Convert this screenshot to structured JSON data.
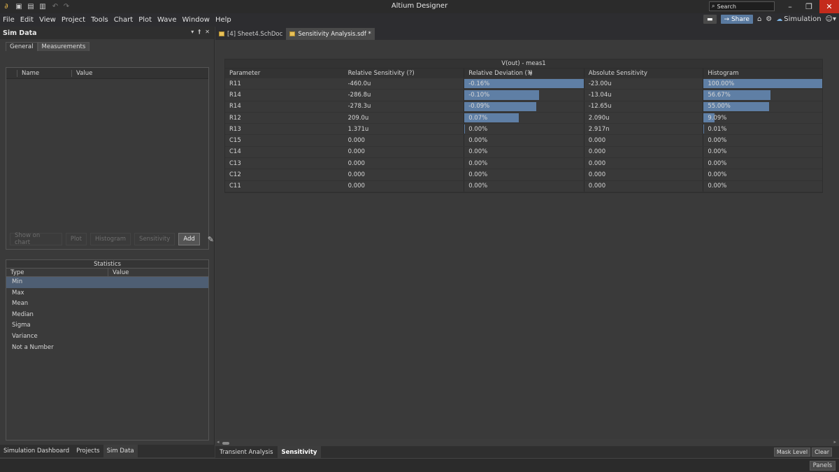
{
  "app": {
    "title": "Altium Designer",
    "search_placeholder": "Search"
  },
  "menu": [
    "File",
    "Edit",
    "View",
    "Project",
    "Tools",
    "Chart",
    "Plot",
    "Wave",
    "Window",
    "Help"
  ],
  "toolbar_right": {
    "share": "Share",
    "simulation": "Simulation"
  },
  "left_panel": {
    "title": "Sim Data",
    "tabs": [
      "General",
      "Measurements"
    ],
    "measure_columns": [
      "Name",
      "Value"
    ],
    "buttons": [
      "Show on chart",
      "Plot",
      "Histogram",
      "Sensitivity",
      "Add"
    ],
    "stats": {
      "title": "Statistics",
      "columns": [
        "Type",
        "Value"
      ],
      "rows": [
        "Min",
        "Max",
        "Mean",
        "Median",
        "Sigma",
        "Variance",
        "Not a Number"
      ]
    },
    "bottom_tabs": [
      "Simulation Dashboard",
      "Projects",
      "Sim Data"
    ]
  },
  "doc_tabs": [
    "[4] Sheet4.SchDoc",
    "Sensitivity Analysis.sdf *"
  ],
  "table": {
    "title": "V(out) - meas1",
    "columns": [
      "Parameter",
      "Relative Sensitivity (?)",
      "Relative Deviation (?)",
      "Absolute Sensitivity",
      "Histogram"
    ],
    "rows": [
      {
        "param": "R11",
        "rel_sens": "-460.0u",
        "rel_dev": "-0.16%",
        "rel_dev_frac": 1.0,
        "abs_sens": "-23.00u",
        "hist": "100.00%",
        "hist_frac": 1.0
      },
      {
        "param": "R14",
        "rel_sens": "-286.8u",
        "rel_dev": "-0.10%",
        "rel_dev_frac": 0.625,
        "abs_sens": "-13.04u",
        "hist": "56.67%",
        "hist_frac": 0.5667
      },
      {
        "param": "R14",
        "rel_sens": "-278.3u",
        "rel_dev": "-0.09%",
        "rel_dev_frac": 0.605,
        "abs_sens": "-12.65u",
        "hist": "55.00%",
        "hist_frac": 0.55
      },
      {
        "param": "R12",
        "rel_sens": "209.0u",
        "rel_dev": "0.07%",
        "rel_dev_frac": 0.454,
        "abs_sens": "2.090u",
        "hist": "9.09%",
        "hist_frac": 0.0909
      },
      {
        "param": "R13",
        "rel_sens": "1.371u",
        "rel_dev": "0.00%",
        "rel_dev_frac": 0.005,
        "abs_sens": "2.917n",
        "hist": "0.01%",
        "hist_frac": 0.005
      },
      {
        "param": "C15",
        "rel_sens": "0.000",
        "rel_dev": "0.00%",
        "rel_dev_frac": 0,
        "abs_sens": "0.000",
        "hist": "0.00%",
        "hist_frac": 0
      },
      {
        "param": "C14",
        "rel_sens": "0.000",
        "rel_dev": "0.00%",
        "rel_dev_frac": 0,
        "abs_sens": "0.000",
        "hist": "0.00%",
        "hist_frac": 0
      },
      {
        "param": "C13",
        "rel_sens": "0.000",
        "rel_dev": "0.00%",
        "rel_dev_frac": 0,
        "abs_sens": "0.000",
        "hist": "0.00%",
        "hist_frac": 0
      },
      {
        "param": "C12",
        "rel_sens": "0.000",
        "rel_dev": "0.00%",
        "rel_dev_frac": 0,
        "abs_sens": "0.000",
        "hist": "0.00%",
        "hist_frac": 0
      },
      {
        "param": "C11",
        "rel_sens": "0.000",
        "rel_dev": "0.00%",
        "rel_dev_frac": 0,
        "abs_sens": "0.000",
        "hist": "0.00%",
        "hist_frac": 0
      }
    ]
  },
  "sheet_tabs": [
    "Transient Analysis",
    "Sensitivity"
  ],
  "sheet_buttons": [
    "Mask Level",
    "Clear"
  ],
  "status": {
    "panels": "Panels"
  }
}
